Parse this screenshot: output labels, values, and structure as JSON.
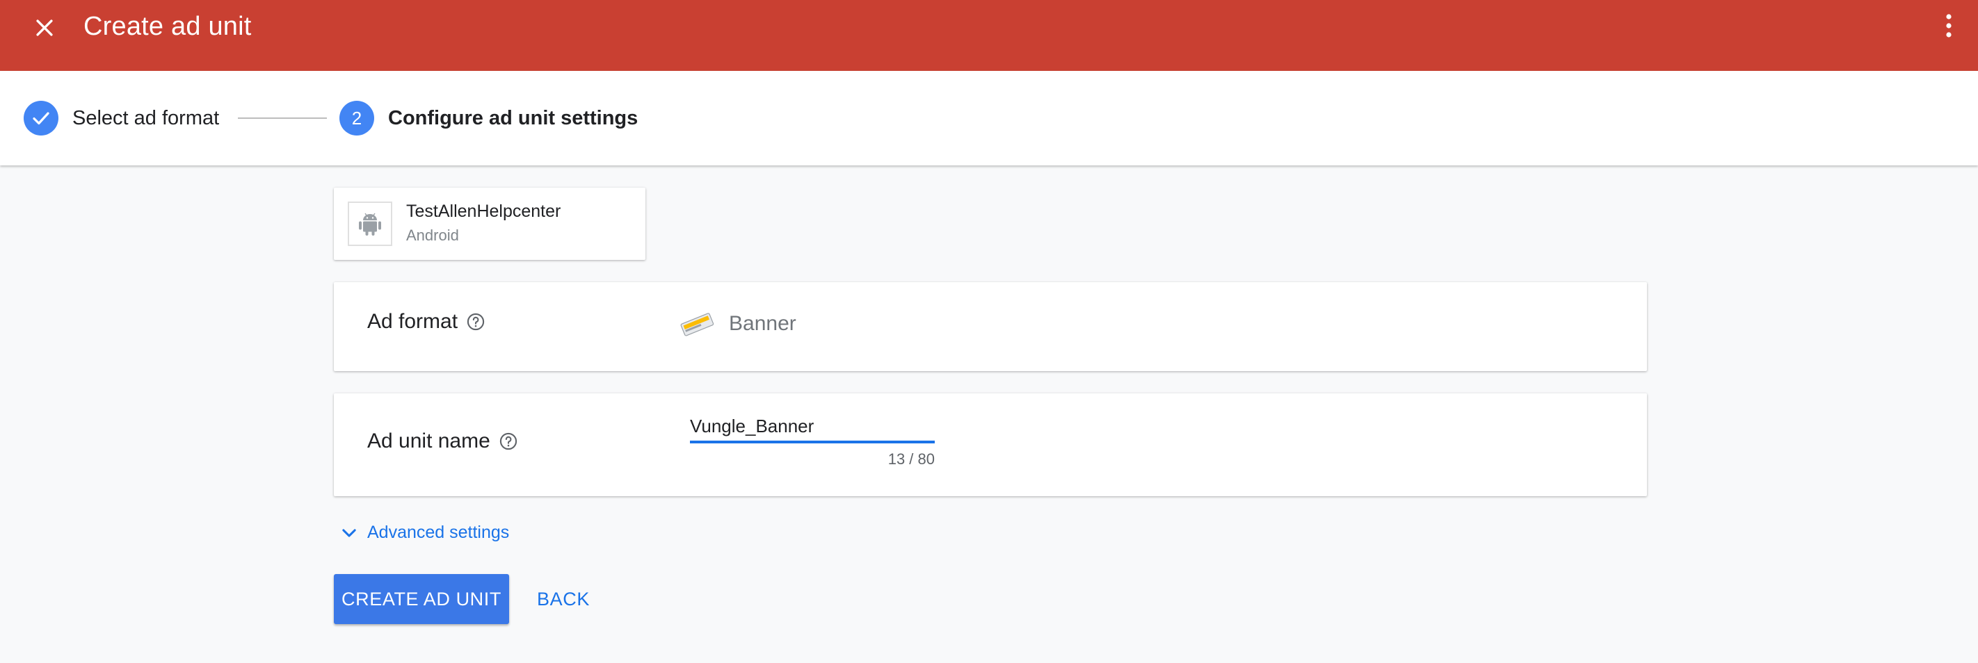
{
  "header": {
    "title": "Create ad unit",
    "close_icon": "close-icon",
    "more_icon": "more-vert-icon",
    "background_color": "#c94032"
  },
  "stepper": {
    "steps": [
      {
        "label": "Select ad format",
        "state": "completed",
        "icon": "check-icon"
      },
      {
        "label": "Configure ad unit settings",
        "state": "active",
        "number": "2"
      }
    ],
    "accent_color": "#4285f4"
  },
  "app": {
    "name": "TestAllenHelpcenter",
    "platform": "Android",
    "icon": "android-icon"
  },
  "ad_format": {
    "label": "Ad format",
    "help_icon": "help-icon",
    "value": "Banner",
    "value_icon": "banner-format-icon"
  },
  "ad_unit_name": {
    "label": "Ad unit name",
    "help_icon": "help-icon",
    "value": "Vungle_Banner",
    "counter": "13 / 80"
  },
  "advanced": {
    "label": "Advanced settings",
    "icon": "chevron-down-icon"
  },
  "actions": {
    "create_label": "CREATE AD UNIT",
    "back_label": "BACK",
    "primary_color": "#3b78e7"
  }
}
